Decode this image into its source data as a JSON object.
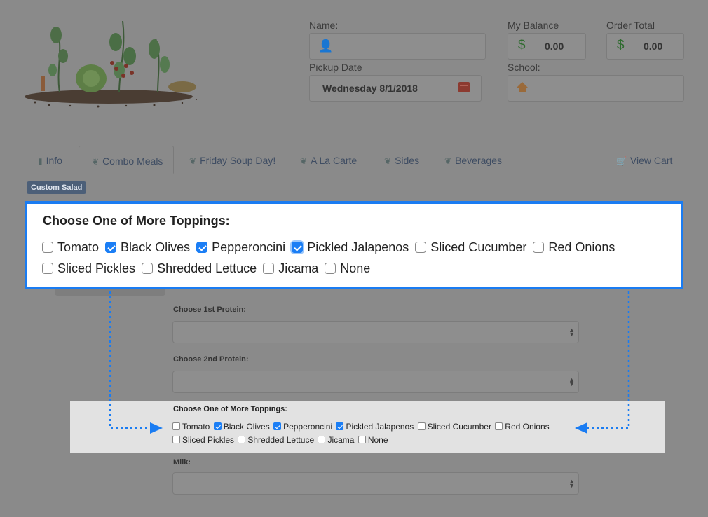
{
  "header": {
    "name_label": "Name:",
    "balance_label": "My Balance",
    "balance_value": "0.00",
    "total_label": "Order Total",
    "total_value": "0.00",
    "pickup_label": "Pickup Date",
    "pickup_value": "Wednesday 8/1/2018",
    "school_label": "School:",
    "currency_symbol": "$"
  },
  "tabs": [
    {
      "label": "Info",
      "icon": "book-icon"
    },
    {
      "label": "Combo Meals",
      "icon": "leaf-icon"
    },
    {
      "label": "Friday Soup Day!",
      "icon": "leaf-icon"
    },
    {
      "label": "A La Carte",
      "icon": "leaf-icon"
    },
    {
      "label": "Sides",
      "icon": "leaf-icon"
    },
    {
      "label": "Beverages",
      "icon": "leaf-icon"
    },
    {
      "label": "View Cart",
      "icon": "cart-icon"
    }
  ],
  "badge": "Custom Salad",
  "form": {
    "protein1_label": "Choose 1st Protein:",
    "protein2_label": "Choose 2nd Protein:",
    "milk_label": "Milk:"
  },
  "toppings": {
    "title": "Choose One of More Toppings:",
    "options": [
      {
        "label": "Tomato",
        "checked": false
      },
      {
        "label": "Black Olives",
        "checked": true
      },
      {
        "label": "Pepperoncini",
        "checked": true
      },
      {
        "label": "Pickled Jalapenos",
        "checked": true
      },
      {
        "label": "Sliced Cucumber",
        "checked": false
      },
      {
        "label": "Red Onions",
        "checked": false
      },
      {
        "label": "Sliced Pickles",
        "checked": false
      },
      {
        "label": "Shredded Lettuce",
        "checked": false
      },
      {
        "label": "Jicama",
        "checked": false
      },
      {
        "label": "None",
        "checked": false
      }
    ]
  },
  "colors": {
    "accent": "#1a7cf2",
    "overlay": "#8a8a8a",
    "highlight_strip": "#e2e2e2"
  }
}
